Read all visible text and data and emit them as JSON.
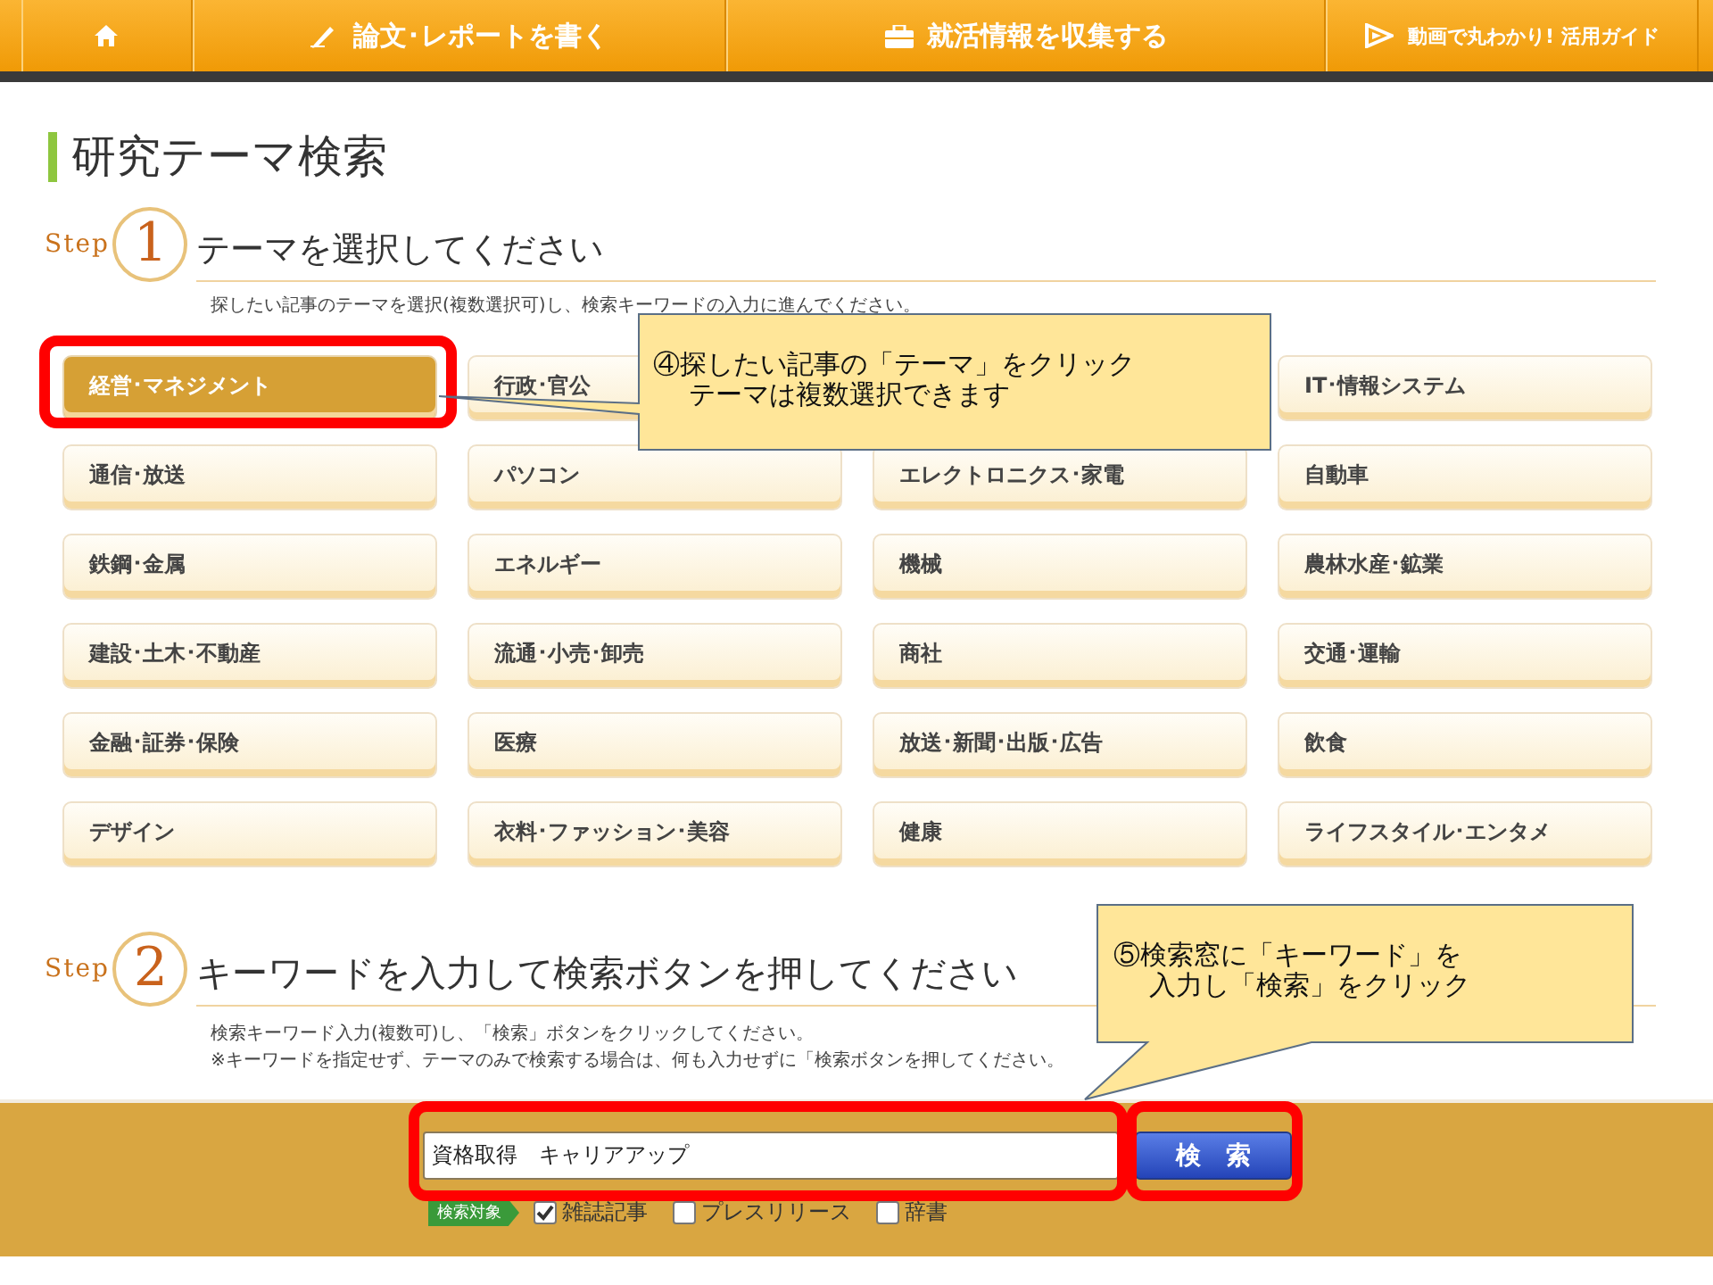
{
  "nav": [
    {
      "kind": "home"
    },
    {
      "kind": "pen",
      "label": "論文･レポートを書く"
    },
    {
      "kind": "briefcase",
      "label": "就活情報を収集する"
    },
    {
      "kind": "play",
      "label": "動画で丸わかり! 活用ガイド"
    }
  ],
  "title": "研究テーマ検索",
  "step1": {
    "step_word": "Step",
    "number": "1",
    "heading": "テーマを選択してください",
    "description": "探したい記事のテーマを選択(複数選択可)し、検索キーワードの入力に進んでください。"
  },
  "themes": [
    [
      {
        "label": "経営･マネジメント",
        "selected": true
      },
      {
        "label": "行政･官公",
        "selected": false
      },
      {
        "label": "IT･情報システム",
        "selected": false
      }
    ],
    [
      {
        "label": "通信･放送",
        "selected": false
      },
      {
        "label": "パソコン",
        "selected": false
      },
      {
        "label": "エレクトロニクス･家電",
        "selected": false
      },
      {
        "label": "自動車",
        "selected": false
      }
    ],
    [
      {
        "label": "鉄鋼･金属",
        "selected": false
      },
      {
        "label": "エネルギー",
        "selected": false
      },
      {
        "label": "機械",
        "selected": false
      },
      {
        "label": "農林水産･鉱業",
        "selected": false
      }
    ],
    [
      {
        "label": "建設･土木･不動産",
        "selected": false
      },
      {
        "label": "流通･小売･卸売",
        "selected": false
      },
      {
        "label": "商社",
        "selected": false
      },
      {
        "label": "交通･運輸",
        "selected": false
      }
    ],
    [
      {
        "label": "金融･証券･保険",
        "selected": false
      },
      {
        "label": "医療",
        "selected": false
      },
      {
        "label": "放送･新聞･出版･広告",
        "selected": false
      },
      {
        "label": "飲食",
        "selected": false
      }
    ],
    [
      {
        "label": "デザイン",
        "selected": false
      },
      {
        "label": "衣料･ファッション･美容",
        "selected": false
      },
      {
        "label": "健康",
        "selected": false
      },
      {
        "label": "ライフスタイル･エンタメ",
        "selected": false
      }
    ]
  ],
  "step2": {
    "step_word": "Step",
    "number": "2",
    "heading": "キーワードを入力して検索ボタンを押してください",
    "notes": [
      "検索キーワード入力(複数可)し、「検索」ボタンをクリックしてください。",
      "※キーワードを指定せず、テーマのみで検索する場合は、何も入力せずに「検索ボタンを押してください。"
    ]
  },
  "search": {
    "value": "資格取得　キャリアアップ",
    "button": "検　索",
    "target_label": "検索対象",
    "targets": [
      {
        "label": "雑誌記事",
        "checked": true
      },
      {
        "label": "プレスリリース",
        "checked": false
      },
      {
        "label": "辞書",
        "checked": false
      }
    ]
  },
  "callouts": [
    {
      "lines": [
        "④探したい記事の「テーマ」をクリック",
        "テーマは複数選択できます"
      ]
    },
    {
      "lines": [
        "⑤検索窓に「キーワード」を",
        "入力し「検索」をクリック"
      ]
    }
  ]
}
